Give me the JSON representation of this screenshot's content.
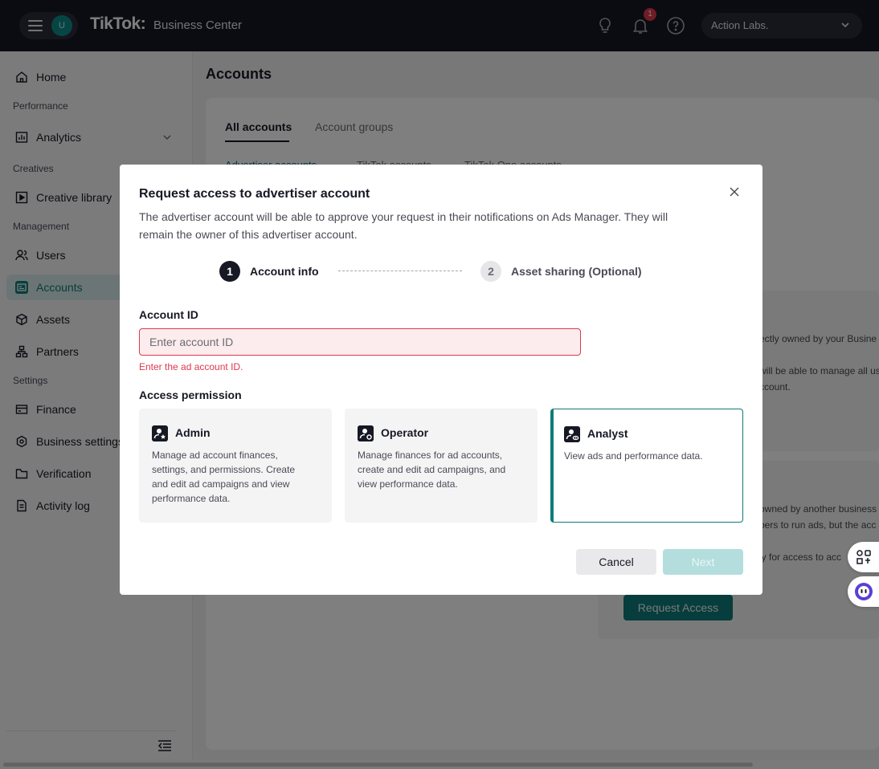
{
  "topbar": {
    "avatar_initial": "U",
    "logo": "TikTok:",
    "logo_sub": "Business Center",
    "notification_count": "1",
    "org_name": "Action Labs."
  },
  "sidebar": {
    "items": [
      {
        "label": "Home"
      },
      {
        "label": "Analytics"
      },
      {
        "label": "Creative library"
      },
      {
        "label": "Users"
      },
      {
        "label": "Accounts"
      },
      {
        "label": "Assets"
      },
      {
        "label": "Partners"
      },
      {
        "label": "Finance"
      },
      {
        "label": "Business settings"
      },
      {
        "label": "Verification"
      },
      {
        "label": "Activity log"
      }
    ],
    "sections": [
      "Performance",
      "Creatives",
      "Management",
      "Settings"
    ]
  },
  "page": {
    "title": "Accounts",
    "tabs": [
      "All accounts",
      "Account groups"
    ],
    "subtabs": [
      "Advertiser accounts",
      "TikTok accounts",
      "TikTok One accounts"
    ],
    "bg_text": [
      "ectly owned by your Busine",
      "will be able to manage all us",
      "ccount.",
      "owned by another business",
      "bers to run ads, but the acc",
      "ly for access to acc"
    ],
    "request_access": "Request Access"
  },
  "modal": {
    "title": "Request access to advertiser account",
    "description": "The advertiser account will be able to approve your request in their notifications on Ads Manager. They will remain the owner of this advertiser account.",
    "steps": [
      {
        "num": "1",
        "label": "Account info"
      },
      {
        "num": "2",
        "label": "Asset sharing (Optional)"
      }
    ],
    "account_id_label": "Account ID",
    "account_id_placeholder": "Enter account ID",
    "account_id_value": "",
    "account_id_error": "Enter the ad account ID.",
    "access_permission_label": "Access permission",
    "permissions": [
      {
        "title": "Admin",
        "desc": "Manage ad account finances, settings, and permissions. Create and edit ad campaigns and view performance data.",
        "selected": false
      },
      {
        "title": "Operator",
        "desc": "Manage finances for ad accounts, create and edit ad campaigns, and view performance data.",
        "selected": false
      },
      {
        "title": "Analyst",
        "desc": "View ads and performance data.",
        "selected": true
      }
    ],
    "cancel": "Cancel",
    "next": "Next"
  },
  "colors": {
    "accent": "#0f7a7a",
    "error": "#e0384b",
    "topbar": "#161823"
  },
  "icons": [
    "hamburger-icon",
    "bulb-icon",
    "bell-icon",
    "help-icon",
    "chevron-down-icon",
    "home-icon",
    "analytics-icon",
    "creative-library-icon",
    "users-icon",
    "accounts-icon",
    "assets-icon",
    "partners-icon",
    "finance-icon",
    "business-settings-icon",
    "verification-icon",
    "activity-log-icon",
    "collapse-icon",
    "close-icon",
    "admin-icon",
    "operator-icon",
    "analyst-icon"
  ]
}
